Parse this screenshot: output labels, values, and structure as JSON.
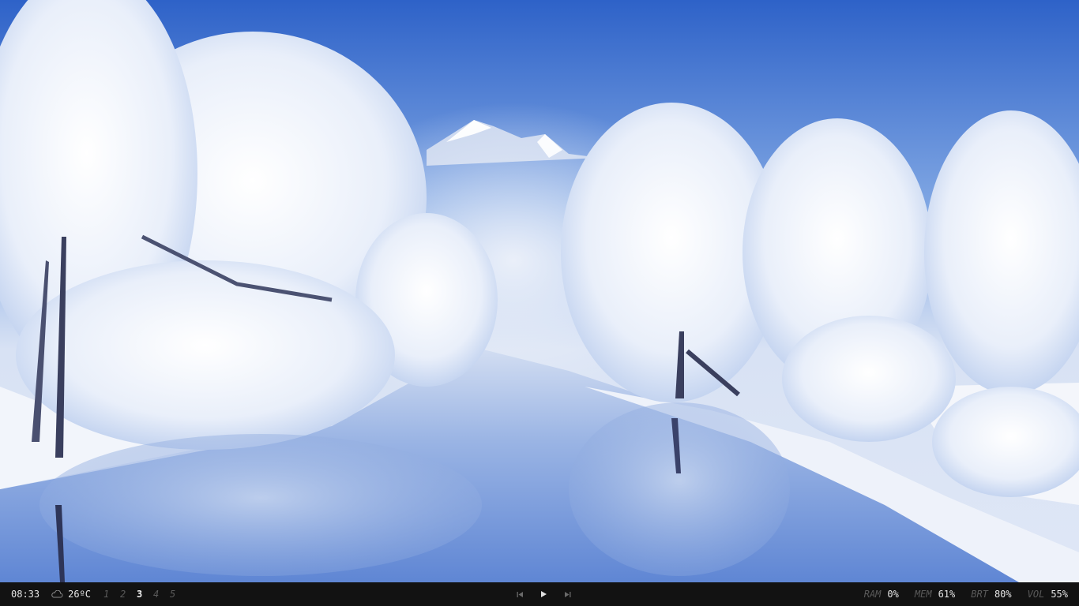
{
  "wallpaper": {
    "description_icon": "winter-river-landscape"
  },
  "statusbar": {
    "clock": "08:33",
    "weather": {
      "icon": "cloud-icon",
      "temperature": "26ºC"
    },
    "workspaces": [
      {
        "label": "1",
        "active": false
      },
      {
        "label": "2",
        "active": false
      },
      {
        "label": "3",
        "active": true
      },
      {
        "label": "4",
        "active": false
      },
      {
        "label": "5",
        "active": false
      }
    ],
    "media": {
      "prev_icon": "skip-previous-icon",
      "play_icon": "play-icon",
      "next_icon": "skip-next-icon"
    },
    "stats": {
      "ram": {
        "label": "RAM",
        "value": "0%"
      },
      "mem": {
        "label": "MEM",
        "value": "61%"
      },
      "brt": {
        "label": "BRT",
        "value": "80%"
      },
      "vol": {
        "label": "VOL",
        "value": "55%"
      }
    }
  },
  "colors": {
    "bar_bg": "#121212",
    "text": "#e6e6e6",
    "muted": "#5a5a5a"
  }
}
